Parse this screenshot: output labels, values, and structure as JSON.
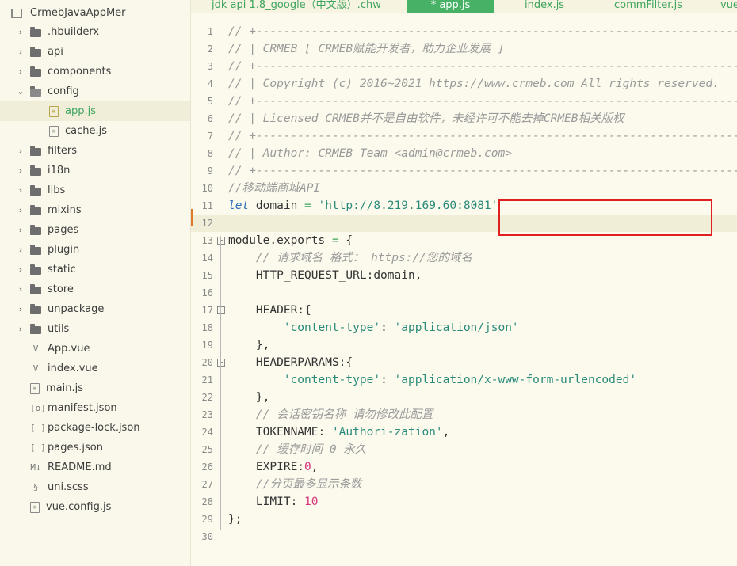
{
  "sidebar": {
    "root": "CrmebJavaAppMer",
    "items": [
      {
        "label": ".hbuilderx",
        "type": "folder"
      },
      {
        "label": "api",
        "type": "folder"
      },
      {
        "label": "components",
        "type": "folder"
      },
      {
        "label": "config",
        "type": "folder-open"
      },
      {
        "label": "app.js",
        "type": "file-js",
        "active": true
      },
      {
        "label": "cache.js",
        "type": "file-js"
      },
      {
        "label": "filters",
        "type": "folder"
      },
      {
        "label": "i18n",
        "type": "folder"
      },
      {
        "label": "libs",
        "type": "folder"
      },
      {
        "label": "mixins",
        "type": "folder"
      },
      {
        "label": "pages",
        "type": "folder"
      },
      {
        "label": "plugin",
        "type": "folder"
      },
      {
        "label": "static",
        "type": "folder"
      },
      {
        "label": "store",
        "type": "folder"
      },
      {
        "label": "unpackage",
        "type": "folder"
      },
      {
        "label": "utils",
        "type": "folder"
      },
      {
        "label": "App.vue",
        "type": "file-vue"
      },
      {
        "label": "index.vue",
        "type": "file-vue"
      },
      {
        "label": "main.js",
        "type": "file-js"
      },
      {
        "label": "manifest.json",
        "type": "file-manifest"
      },
      {
        "label": "package-lock.json",
        "type": "file-json"
      },
      {
        "label": "pages.json",
        "type": "file-json"
      },
      {
        "label": "README.md",
        "type": "file-md"
      },
      {
        "label": "uni.scss",
        "type": "file-scss"
      },
      {
        "label": "vue.config.js",
        "type": "file-js"
      }
    ]
  },
  "tabs": [
    {
      "label": "jdk api 1.8_google（中文版）.chw"
    },
    {
      "label": "* app.js",
      "active": true
    },
    {
      "label": "index.js"
    },
    {
      "label": "commFilter.js"
    },
    {
      "label": "vue"
    }
  ],
  "editor": {
    "current_line": 12,
    "lines": [
      {
        "n": "1",
        "tokens": [
          [
            "cm",
            "// +----------------------------------------------------------------------------------"
          ]
        ]
      },
      {
        "n": "2",
        "tokens": [
          [
            "cm",
            "// | CRMEB [ CRMEB赋能开发者，助力企业发展 ]"
          ]
        ]
      },
      {
        "n": "3",
        "tokens": [
          [
            "cm",
            "// +----------------------------------------------------------------------------------"
          ]
        ]
      },
      {
        "n": "4",
        "tokens": [
          [
            "cm",
            "// | Copyright (c) 2016~2021 https://www.crmeb.com All rights reserved."
          ]
        ]
      },
      {
        "n": "5",
        "tokens": [
          [
            "cm",
            "// +----------------------------------------------------------------------------------"
          ]
        ]
      },
      {
        "n": "6",
        "tokens": [
          [
            "cm",
            "// | Licensed CRMEB并不是自由软件，未经许可不能去掉CRMEB相关版权"
          ]
        ]
      },
      {
        "n": "7",
        "tokens": [
          [
            "cm",
            "// +----------------------------------------------------------------------------------"
          ]
        ]
      },
      {
        "n": "8",
        "tokens": [
          [
            "cm",
            "// | Author: CRMEB Team <admin@crmeb.com>"
          ]
        ]
      },
      {
        "n": "9",
        "tokens": [
          [
            "cm",
            "// +----------------------------------------------------------------------------------"
          ]
        ]
      },
      {
        "n": "10",
        "tokens": [
          [
            "cm",
            "//移动端商城API"
          ]
        ]
      },
      {
        "n": "11",
        "tokens": [
          [
            "kw",
            "let"
          ],
          [
            "",
            " domain "
          ],
          [
            "op",
            "="
          ],
          [
            "",
            " "
          ],
          [
            "str",
            "'http://8.219.169.60:8081'"
          ]
        ]
      },
      {
        "n": "12",
        "tokens": []
      },
      {
        "n": "13",
        "fold": "⊟",
        "tokens": [
          [
            "",
            "module.exports "
          ],
          [
            "op",
            "="
          ],
          [
            "",
            " {"
          ]
        ]
      },
      {
        "n": "14",
        "tokens": [
          [
            "",
            "    "
          ],
          [
            "cm",
            "// 请求域名 格式： https://您的域名"
          ]
        ]
      },
      {
        "n": "15",
        "tokens": [
          [
            "",
            "    HTTP_REQUEST_URL:domain,"
          ]
        ]
      },
      {
        "n": "16",
        "tokens": []
      },
      {
        "n": "17",
        "fold": "⊟",
        "tokens": [
          [
            "",
            "    HEADER:{"
          ]
        ]
      },
      {
        "n": "18",
        "tokens": [
          [
            "",
            "        "
          ],
          [
            "str",
            "'content-type'"
          ],
          [
            "",
            ": "
          ],
          [
            "str",
            "'application/json'"
          ]
        ]
      },
      {
        "n": "19",
        "tokens": [
          [
            "",
            "    },"
          ]
        ]
      },
      {
        "n": "20",
        "fold": "⊟",
        "tokens": [
          [
            "",
            "    HEADERPARAMS:{"
          ]
        ]
      },
      {
        "n": "21",
        "tokens": [
          [
            "",
            "        "
          ],
          [
            "str",
            "'content-type'"
          ],
          [
            "",
            ": "
          ],
          [
            "str",
            "'application/x-www-form-urlencoded'"
          ]
        ]
      },
      {
        "n": "22",
        "tokens": [
          [
            "",
            "    },"
          ]
        ]
      },
      {
        "n": "23",
        "tokens": [
          [
            "",
            "    "
          ],
          [
            "cm",
            "// 会话密钥名称 请勿修改此配置"
          ]
        ]
      },
      {
        "n": "24",
        "tokens": [
          [
            "",
            "    TOKENNAME: "
          ],
          [
            "str",
            "'Authori-zation'"
          ],
          [
            "",
            ","
          ]
        ]
      },
      {
        "n": "25",
        "tokens": [
          [
            "",
            "    "
          ],
          [
            "cm",
            "// 缓存时间 0 永久"
          ]
        ]
      },
      {
        "n": "26",
        "tokens": [
          [
            "",
            "    EXPIRE:"
          ],
          [
            "num",
            "0"
          ],
          [
            "",
            ","
          ]
        ]
      },
      {
        "n": "27",
        "tokens": [
          [
            "",
            "    "
          ],
          [
            "cm",
            "//分页最多显示条数"
          ]
        ]
      },
      {
        "n": "28",
        "tokens": [
          [
            "",
            "    LIMIT: "
          ],
          [
            "num",
            "10"
          ]
        ]
      },
      {
        "n": "29",
        "tokens": [
          [
            "",
            "};"
          ]
        ]
      },
      {
        "n": "30",
        "tokens": []
      }
    ]
  }
}
